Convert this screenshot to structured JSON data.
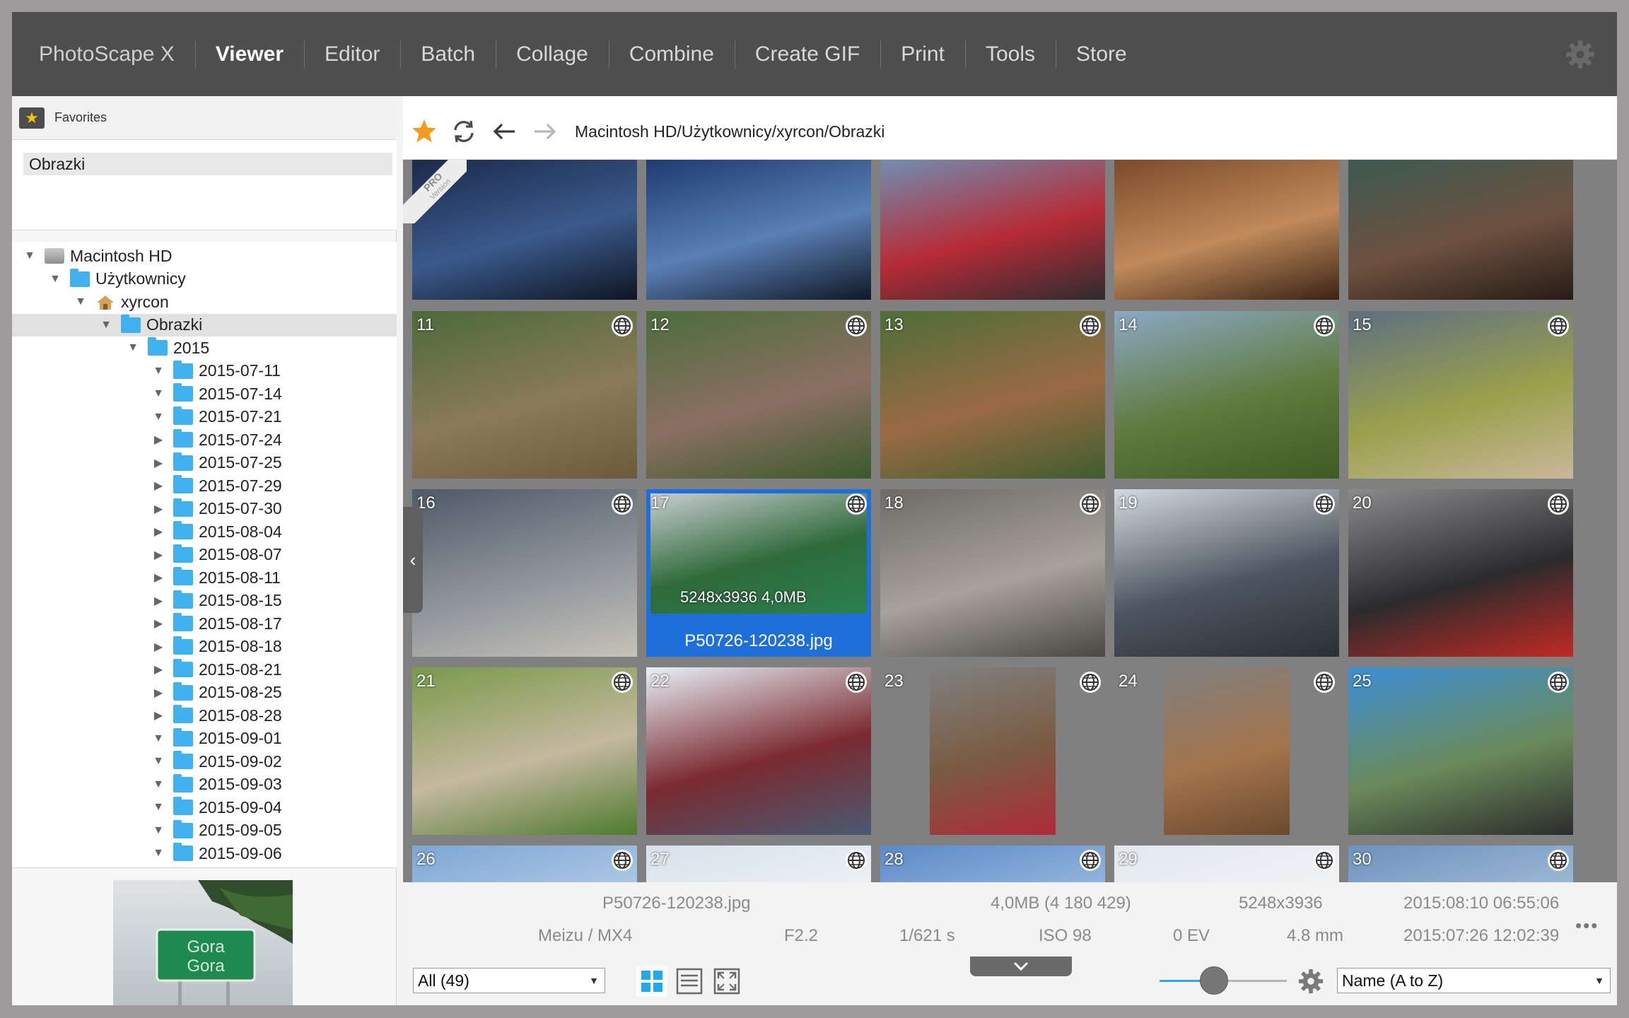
{
  "nav": {
    "items": [
      {
        "label": "PhotoScape X",
        "active": false
      },
      {
        "label": "Viewer",
        "active": true
      },
      {
        "label": "Editor",
        "active": false
      },
      {
        "label": "Batch",
        "active": false
      },
      {
        "label": "Collage",
        "active": false
      },
      {
        "label": "Combine",
        "active": false
      },
      {
        "label": "Create GIF",
        "active": false
      },
      {
        "label": "Print",
        "active": false
      },
      {
        "label": "Tools",
        "active": false
      },
      {
        "label": "Store",
        "active": false
      }
    ],
    "settings_icon": "gear-icon"
  },
  "sidebar": {
    "favorites_label": "Favorites",
    "favorites": [
      "Obrazki"
    ],
    "tree": [
      {
        "label": "Macintosh HD",
        "level": 0,
        "icon": "disk",
        "expanded": true
      },
      {
        "label": "Użytkownicy",
        "level": 1,
        "icon": "folder",
        "expanded": true
      },
      {
        "label": "xyrcon",
        "level": 2,
        "icon": "home",
        "expanded": true
      },
      {
        "label": "Obrazki",
        "level": 3,
        "icon": "folder",
        "expanded": true,
        "selected": true
      },
      {
        "label": "2015",
        "level": 4,
        "icon": "folder",
        "expanded": true
      },
      {
        "label": "2015-07-11",
        "level": 5,
        "icon": "folder",
        "expanded": true
      },
      {
        "label": "2015-07-14",
        "level": 5,
        "icon": "folder",
        "expanded": true
      },
      {
        "label": "2015-07-21",
        "level": 5,
        "icon": "folder",
        "expanded": true
      },
      {
        "label": "2015-07-24",
        "level": 5,
        "icon": "folder",
        "expanded": false
      },
      {
        "label": "2015-07-25",
        "level": 5,
        "icon": "folder",
        "expanded": false
      },
      {
        "label": "2015-07-29",
        "level": 5,
        "icon": "folder",
        "expanded": false
      },
      {
        "label": "2015-07-30",
        "level": 5,
        "icon": "folder",
        "expanded": false
      },
      {
        "label": "2015-08-04",
        "level": 5,
        "icon": "folder",
        "expanded": false
      },
      {
        "label": "2015-08-07",
        "level": 5,
        "icon": "folder",
        "expanded": false
      },
      {
        "label": "2015-08-11",
        "level": 5,
        "icon": "folder",
        "expanded": false
      },
      {
        "label": "2015-08-15",
        "level": 5,
        "icon": "folder",
        "expanded": false
      },
      {
        "label": "2015-08-17",
        "level": 5,
        "icon": "folder",
        "expanded": false
      },
      {
        "label": "2015-08-18",
        "level": 5,
        "icon": "folder",
        "expanded": false
      },
      {
        "label": "2015-08-21",
        "level": 5,
        "icon": "folder",
        "expanded": false
      },
      {
        "label": "2015-08-25",
        "level": 5,
        "icon": "folder",
        "expanded": false
      },
      {
        "label": "2015-08-28",
        "level": 5,
        "icon": "folder",
        "expanded": false
      },
      {
        "label": "2015-09-01",
        "level": 5,
        "icon": "folder",
        "expanded": true
      },
      {
        "label": "2015-09-02",
        "level": 5,
        "icon": "folder",
        "expanded": true
      },
      {
        "label": "2015-09-03",
        "level": 5,
        "icon": "folder",
        "expanded": true
      },
      {
        "label": "2015-09-04",
        "level": 5,
        "icon": "folder",
        "expanded": true
      },
      {
        "label": "2015-09-05",
        "level": 5,
        "icon": "folder",
        "expanded": true
      },
      {
        "label": "2015-09-06",
        "level": 5,
        "icon": "folder",
        "expanded": true
      }
    ],
    "preview_sign": [
      "Gora",
      "Gora"
    ]
  },
  "toolbar": {
    "path": "Macintosh HD/Użytkownicy/xyrcon/Obrazki",
    "icons": [
      "star-icon",
      "refresh-icon",
      "back-arrow-icon",
      "forward-arrow-icon"
    ]
  },
  "pro_badge": {
    "line1": "PRO",
    "line2": "Version"
  },
  "thumbnails": [
    {
      "num": "",
      "globe": false,
      "colors": [
        "#1b2a4a",
        "#3a5a8c",
        "#0f1522"
      ]
    },
    {
      "num": "",
      "globe": false,
      "colors": [
        "#1d3b6e",
        "#5a7fb6",
        "#101826"
      ]
    },
    {
      "num": "",
      "globe": false,
      "colors": [
        "#6f8fb4",
        "#b62b36",
        "#2c2c30"
      ]
    },
    {
      "num": "",
      "globe": false,
      "colors": [
        "#7a4a2a",
        "#c08a5a",
        "#3a2416"
      ]
    },
    {
      "num": "",
      "globe": false,
      "colors": [
        "#3b5a52",
        "#6e5140",
        "#251c16"
      ]
    },
    {
      "num": "11",
      "globe": true,
      "colors": [
        "#4c6a3a",
        "#8a7a58",
        "#6b5b3c"
      ]
    },
    {
      "num": "12",
      "globe": true,
      "colors": [
        "#4b6d3b",
        "#8c6f63",
        "#3a5a2c"
      ]
    },
    {
      "num": "13",
      "globe": true,
      "colors": [
        "#4d6e38",
        "#9a6a44",
        "#3f5d2f"
      ]
    },
    {
      "num": "14",
      "globe": true,
      "colors": [
        "#8ba8c4",
        "#5f7a3c",
        "#3f5a24"
      ]
    },
    {
      "num": "15",
      "globe": true,
      "colors": [
        "#5e6f82",
        "#9aa04c",
        "#c9b79a"
      ]
    },
    {
      "num": "16",
      "globe": true,
      "colors": [
        "#4f5a68",
        "#8f959c",
        "#c6c2b8"
      ]
    },
    {
      "num": "17",
      "globe": true,
      "colors": [
        "#c8ccd0",
        "#2f6a3a",
        "#2a8050"
      ],
      "selected": true,
      "dims": "5248x3936   4,0MB",
      "name": "P50726-120238.jpg"
    },
    {
      "num": "18",
      "globe": true,
      "colors": [
        "#6e6a66",
        "#a7a29b",
        "#4a4642"
      ]
    },
    {
      "num": "19",
      "globe": true,
      "colors": [
        "#d3d9e0",
        "#4d5560",
        "#2b3038"
      ]
    },
    {
      "num": "20",
      "globe": true,
      "colors": [
        "#8a8b8c",
        "#2b2b2d",
        "#c12a24"
      ]
    },
    {
      "num": "21",
      "globe": true,
      "colors": [
        "#7a9a4a",
        "#c5b8a0",
        "#4e7a2e"
      ]
    },
    {
      "num": "22",
      "globe": true,
      "colors": [
        "#e8f0f8",
        "#7a2a30",
        "#4a5a72"
      ]
    },
    {
      "num": "23",
      "globe": true,
      "colors": [
        "#808080",
        "#7a5a40",
        "#b02a3a"
      ],
      "portrait": true
    },
    {
      "num": "24",
      "globe": true,
      "colors": [
        "#808080",
        "#a4744c",
        "#6a4a30"
      ],
      "portrait": true
    },
    {
      "num": "25",
      "globe": true,
      "colors": [
        "#3d8ed6",
        "#6a8a5a",
        "#2c2c2c"
      ]
    },
    {
      "num": "26",
      "globe": true,
      "colors": [
        "#7ea6d4",
        "#b8d0ea",
        "#a0b8d8"
      ]
    },
    {
      "num": "27",
      "globe": true,
      "colors": [
        "#d8e2ec",
        "#f0f4f8",
        "#c8d4e0"
      ]
    },
    {
      "num": "28",
      "globe": true,
      "colors": [
        "#5c8ac8",
        "#a2c0e2",
        "#86aad6"
      ]
    },
    {
      "num": "29",
      "globe": true,
      "colors": [
        "#e2e8ee",
        "#f4f6f8",
        "#d4dce4"
      ]
    },
    {
      "num": "30",
      "globe": true,
      "colors": [
        "#6e92bc",
        "#a8c2dc",
        "#90b0d0"
      ]
    }
  ],
  "info": {
    "filename": "P50726-120238.jpg",
    "size": "4,0MB (4 180 429)",
    "dimensions": "5248x3936",
    "modified": "2015:08:10 06:55:06",
    "camera": "Meizu / MX4",
    "aperture": "F2.2",
    "shutter": "1/621 s",
    "iso": "ISO 98",
    "ev": "0 EV",
    "focal": "4.8 mm",
    "taken": "2015:07:26 12:02:39",
    "more": "•••"
  },
  "bottombar": {
    "filter": "All (49)",
    "sort": "Name (A to Z)",
    "zoom_fraction": 0.43
  }
}
